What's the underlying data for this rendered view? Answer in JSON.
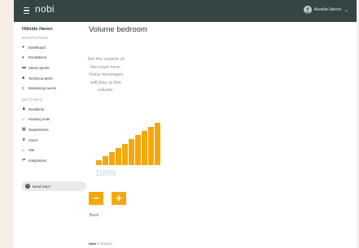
{
  "header": {
    "logo": "nobi",
    "user_name": "Aurelie Hervo",
    "caret": "⌄"
  },
  "sidebar": {
    "org_name": "Hillside Haven",
    "monitoring_label": "MONITORING",
    "monitoring_items": [
      {
        "label": "Dashboard",
        "icon": "●"
      },
      {
        "label": "Escalations",
        "icon": "♦"
      },
      {
        "label": "Sleep reports",
        "icon": "▬"
      },
      {
        "label": "Technical alerts",
        "icon": "■"
      },
      {
        "label": "Monitoring events",
        "icon": "≡"
      }
    ],
    "settings_label": "SETTINGS",
    "settings_items": [
      {
        "label": "Residents",
        "icon": "♟"
      },
      {
        "label": "Housing units",
        "icon": "⌂"
      },
      {
        "label": "Departments",
        "icon": "▦"
      },
      {
        "label": "Users",
        "icon": "♛"
      },
      {
        "label": "Site",
        "icon": "⌂"
      },
      {
        "label": "Integrations",
        "icon": "⇄"
      }
    ],
    "help_label": "Need help?",
    "help_icon": "?"
  },
  "main": {
    "title": "Volume bedroom",
    "instruction": "Set the volume of the room here. Voice messages will play at this volume.",
    "volume": {
      "level": 10,
      "max_level": 10,
      "value_label": "100%",
      "color": "#f5a80e"
    },
    "minus_label": "−",
    "plus_label": "+",
    "back_label": "Back"
  },
  "footer": {
    "brand": "Nobi",
    "text": "© 2018-24"
  }
}
